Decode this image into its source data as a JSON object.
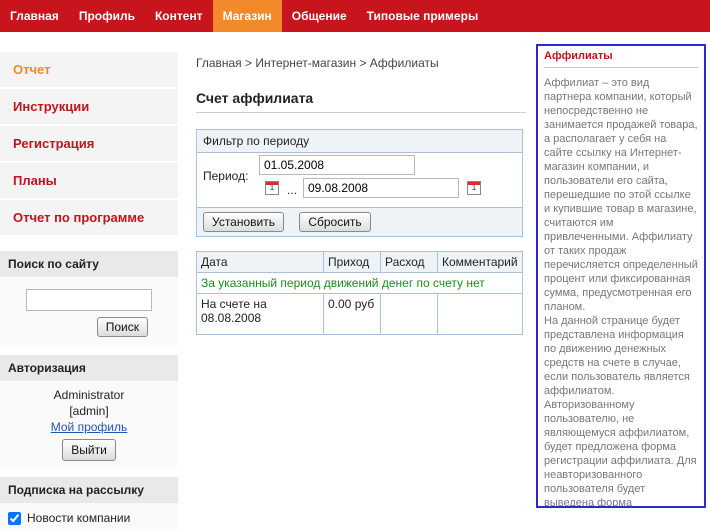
{
  "topnav": {
    "items": [
      "Главная",
      "Профиль",
      "Контент",
      "Магазин",
      "Общение",
      "Типовые примеры"
    ],
    "active_index": 3
  },
  "sidebar": {
    "menu": [
      "Отчет",
      "Инструкции",
      "Регистрация",
      "Планы",
      "Отчет по программе"
    ],
    "search": {
      "title": "Поиск по сайту",
      "button": "Поиск",
      "value": ""
    },
    "auth": {
      "title": "Авторизация",
      "username": "Administrator",
      "login": "[admin]",
      "profile_link": "Мой профиль",
      "logout_button": "Выйти"
    },
    "subscribe": {
      "title": "Подписка на рассылку",
      "option": "Новости компании",
      "checked": true
    }
  },
  "main": {
    "breadcrumb": "Главная > Интернет-магазин > Аффилиаты",
    "title": "Счет аффилиата",
    "filter": {
      "title": "Фильтр по периоду",
      "period_label": "Период:",
      "date_from": "01.05.2008",
      "ellipsis": "...",
      "date_to": "09.08.2008",
      "set_button": "Установить",
      "reset_button": "Сбросить"
    },
    "table": {
      "headers": [
        "Дата",
        "Приход",
        "Расход",
        "Комментарий"
      ],
      "empty_message": "За указанный период движений денег по счету нет",
      "row": {
        "date": "На счете на 08.08.2008",
        "income": "0.00 руб",
        "expense": "",
        "comment": ""
      }
    }
  },
  "info": {
    "title": "Аффилиаты",
    "text": "Аффилиат – это вид партнера компании, который непосредственно не занимается продажей товара, а располагает у себя на сайте ссылку на Интернет-магазин компании, и пользователи его сайта, перешедшие по этой ссылке и купившие товар в магазине, считаются им привлеченными. Аффилиату от таких продаж перечисляется определенный процент или фиксированная сумма, предусмотренная его планом.\nНа данной странице будет представлена информация по движению денежных средств на счете в случае, если пользователь является аффилиатом. Авторизованному пользователю, не являющемуся аффилиатом, будет предложена форма регистрации аффилиата. Для неавторизованного пользователя будет выведена форма авторизации и форма для регистрации на сайте."
  },
  "colors": {
    "brand_red": "#c8141d",
    "active_orange": "#f28a2c",
    "info_border": "#2a2ad0",
    "empty_green": "#1e8b1e"
  }
}
